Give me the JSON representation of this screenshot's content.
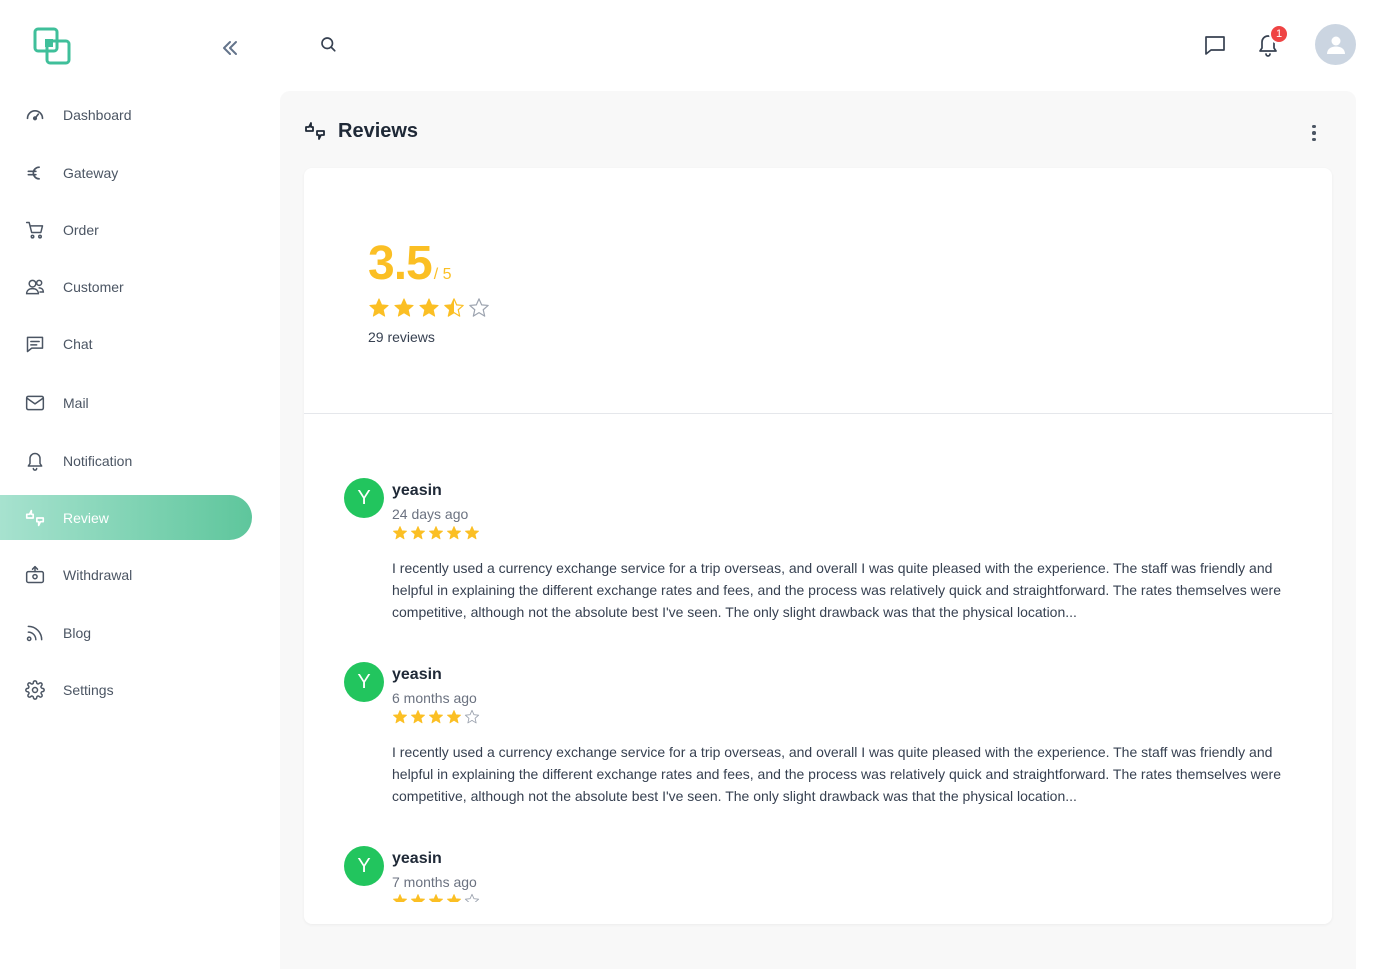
{
  "sidebar": {
    "items": [
      {
        "label": "Dashboard",
        "icon": "dashboard-icon"
      },
      {
        "label": "Gateway",
        "icon": "euro-icon"
      },
      {
        "label": "Order",
        "icon": "cart-icon"
      },
      {
        "label": "Customer",
        "icon": "users-icon"
      },
      {
        "label": "Chat",
        "icon": "chat-icon"
      },
      {
        "label": "Mail",
        "icon": "mail-icon"
      },
      {
        "label": "Notification",
        "icon": "bell-icon"
      },
      {
        "label": "Review",
        "icon": "review-icon",
        "active": true
      },
      {
        "label": "Withdrawal",
        "icon": "withdrawal-icon"
      },
      {
        "label": "Blog",
        "icon": "blog-icon"
      },
      {
        "label": "Settings",
        "icon": "gear-icon"
      }
    ]
  },
  "topbar": {
    "notification_count": "1"
  },
  "page": {
    "title": "Reviews"
  },
  "summary": {
    "rating": "3.5",
    "max": "/ 5",
    "rating_value": 3.5,
    "count_label": "29 reviews"
  },
  "reviews": [
    {
      "initial": "Y",
      "name": "yeasin",
      "time": "24 days ago",
      "stars": 5,
      "text": "I recently used a currency exchange service for a trip overseas, and overall I was quite pleased with the experience. The staff was friendly and helpful in explaining the different exchange rates and fees, and the process was relatively quick and straightforward. The rates themselves were competitive, although not the absolute best I've seen. The only slight drawback was that the physical location..."
    },
    {
      "initial": "Y",
      "name": "yeasin",
      "time": "6 months ago",
      "stars": 4,
      "text": "I recently used a currency exchange service for a trip overseas, and overall I was quite pleased with the experience. The staff was friendly and helpful in explaining the different exchange rates and fees, and the process was relatively quick and straightforward. The rates themselves were competitive, although not the absolute best I've seen. The only slight drawback was that the physical location..."
    },
    {
      "initial": "Y",
      "name": "yeasin",
      "time": "7 months ago",
      "stars": 4,
      "text": ""
    }
  ],
  "colors": {
    "accent": "#5ec69c",
    "star": "#fbbf24",
    "avatar_green": "#22c55e",
    "badge_red": "#ef4444"
  }
}
